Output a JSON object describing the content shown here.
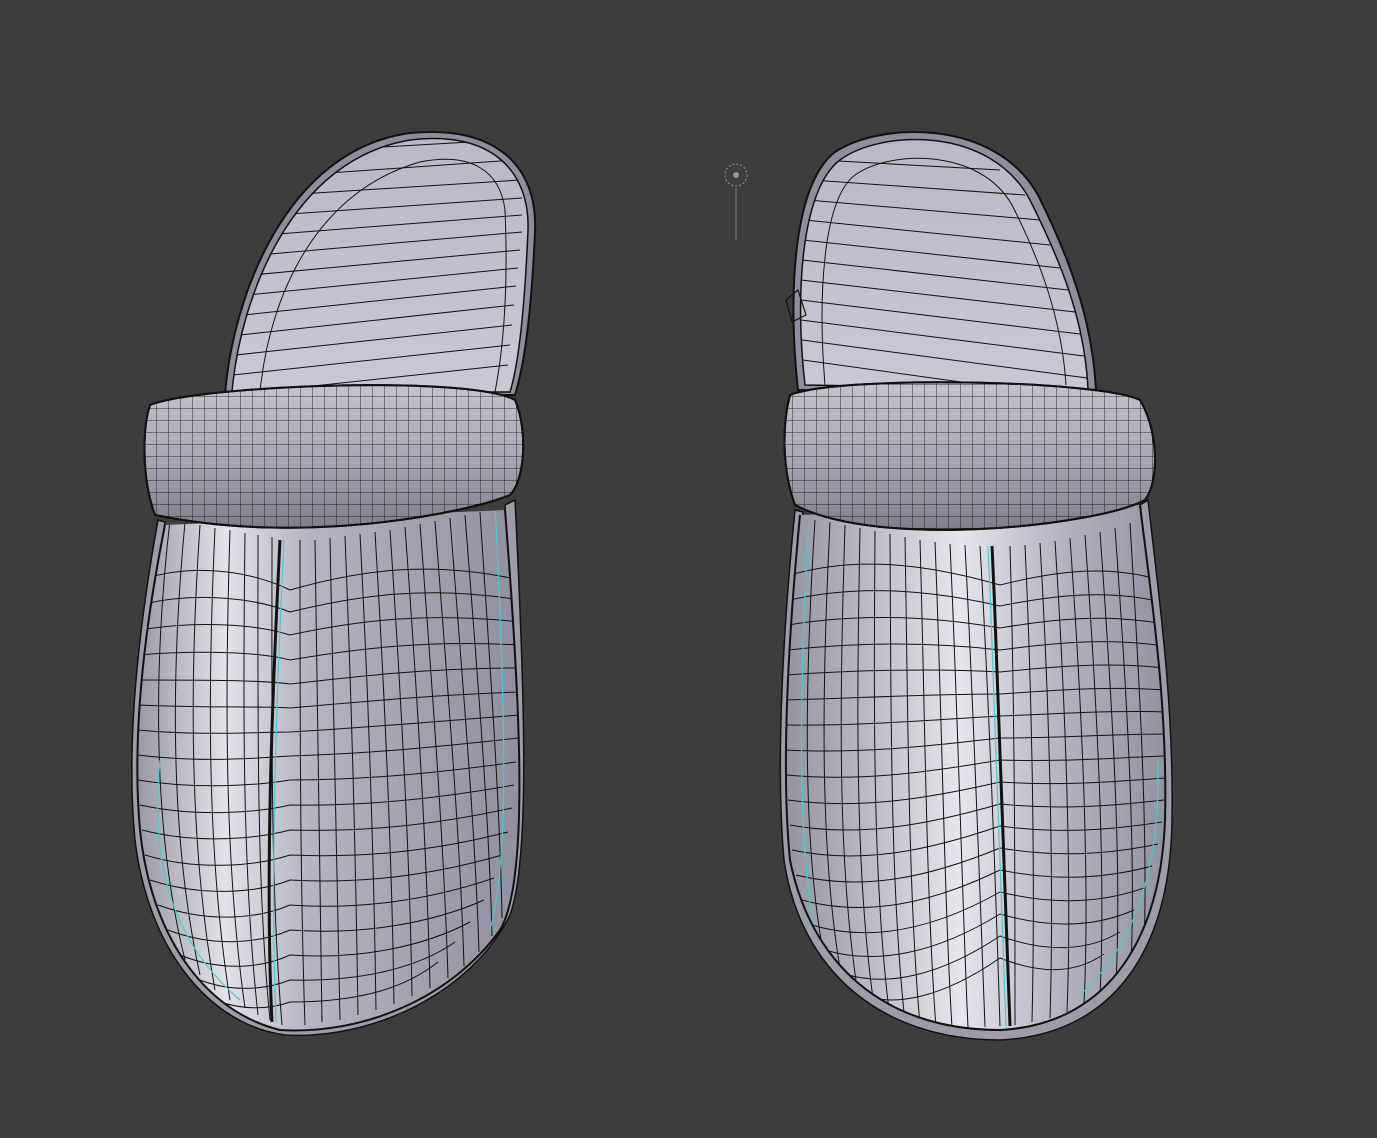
{
  "viewport": {
    "background": "#3d3d3d",
    "mesh_fill_light": "#dcdce4",
    "mesh_fill_mid": "#a9a9b8",
    "mesh_fill_dark": "#6e6e7c",
    "wire_color": "#111111",
    "seam_color": "#3ecfcf"
  },
  "objects": [
    {
      "name": "slipper-left",
      "parts": [
        "insole",
        "collar",
        "toe-cap",
        "sole-rim"
      ]
    },
    {
      "name": "slipper-right",
      "parts": [
        "insole",
        "collar",
        "toe-cap",
        "sole-rim"
      ]
    }
  ],
  "gizmos": {
    "light_icon": "light-icon",
    "empty_icon": "empty-icon"
  }
}
